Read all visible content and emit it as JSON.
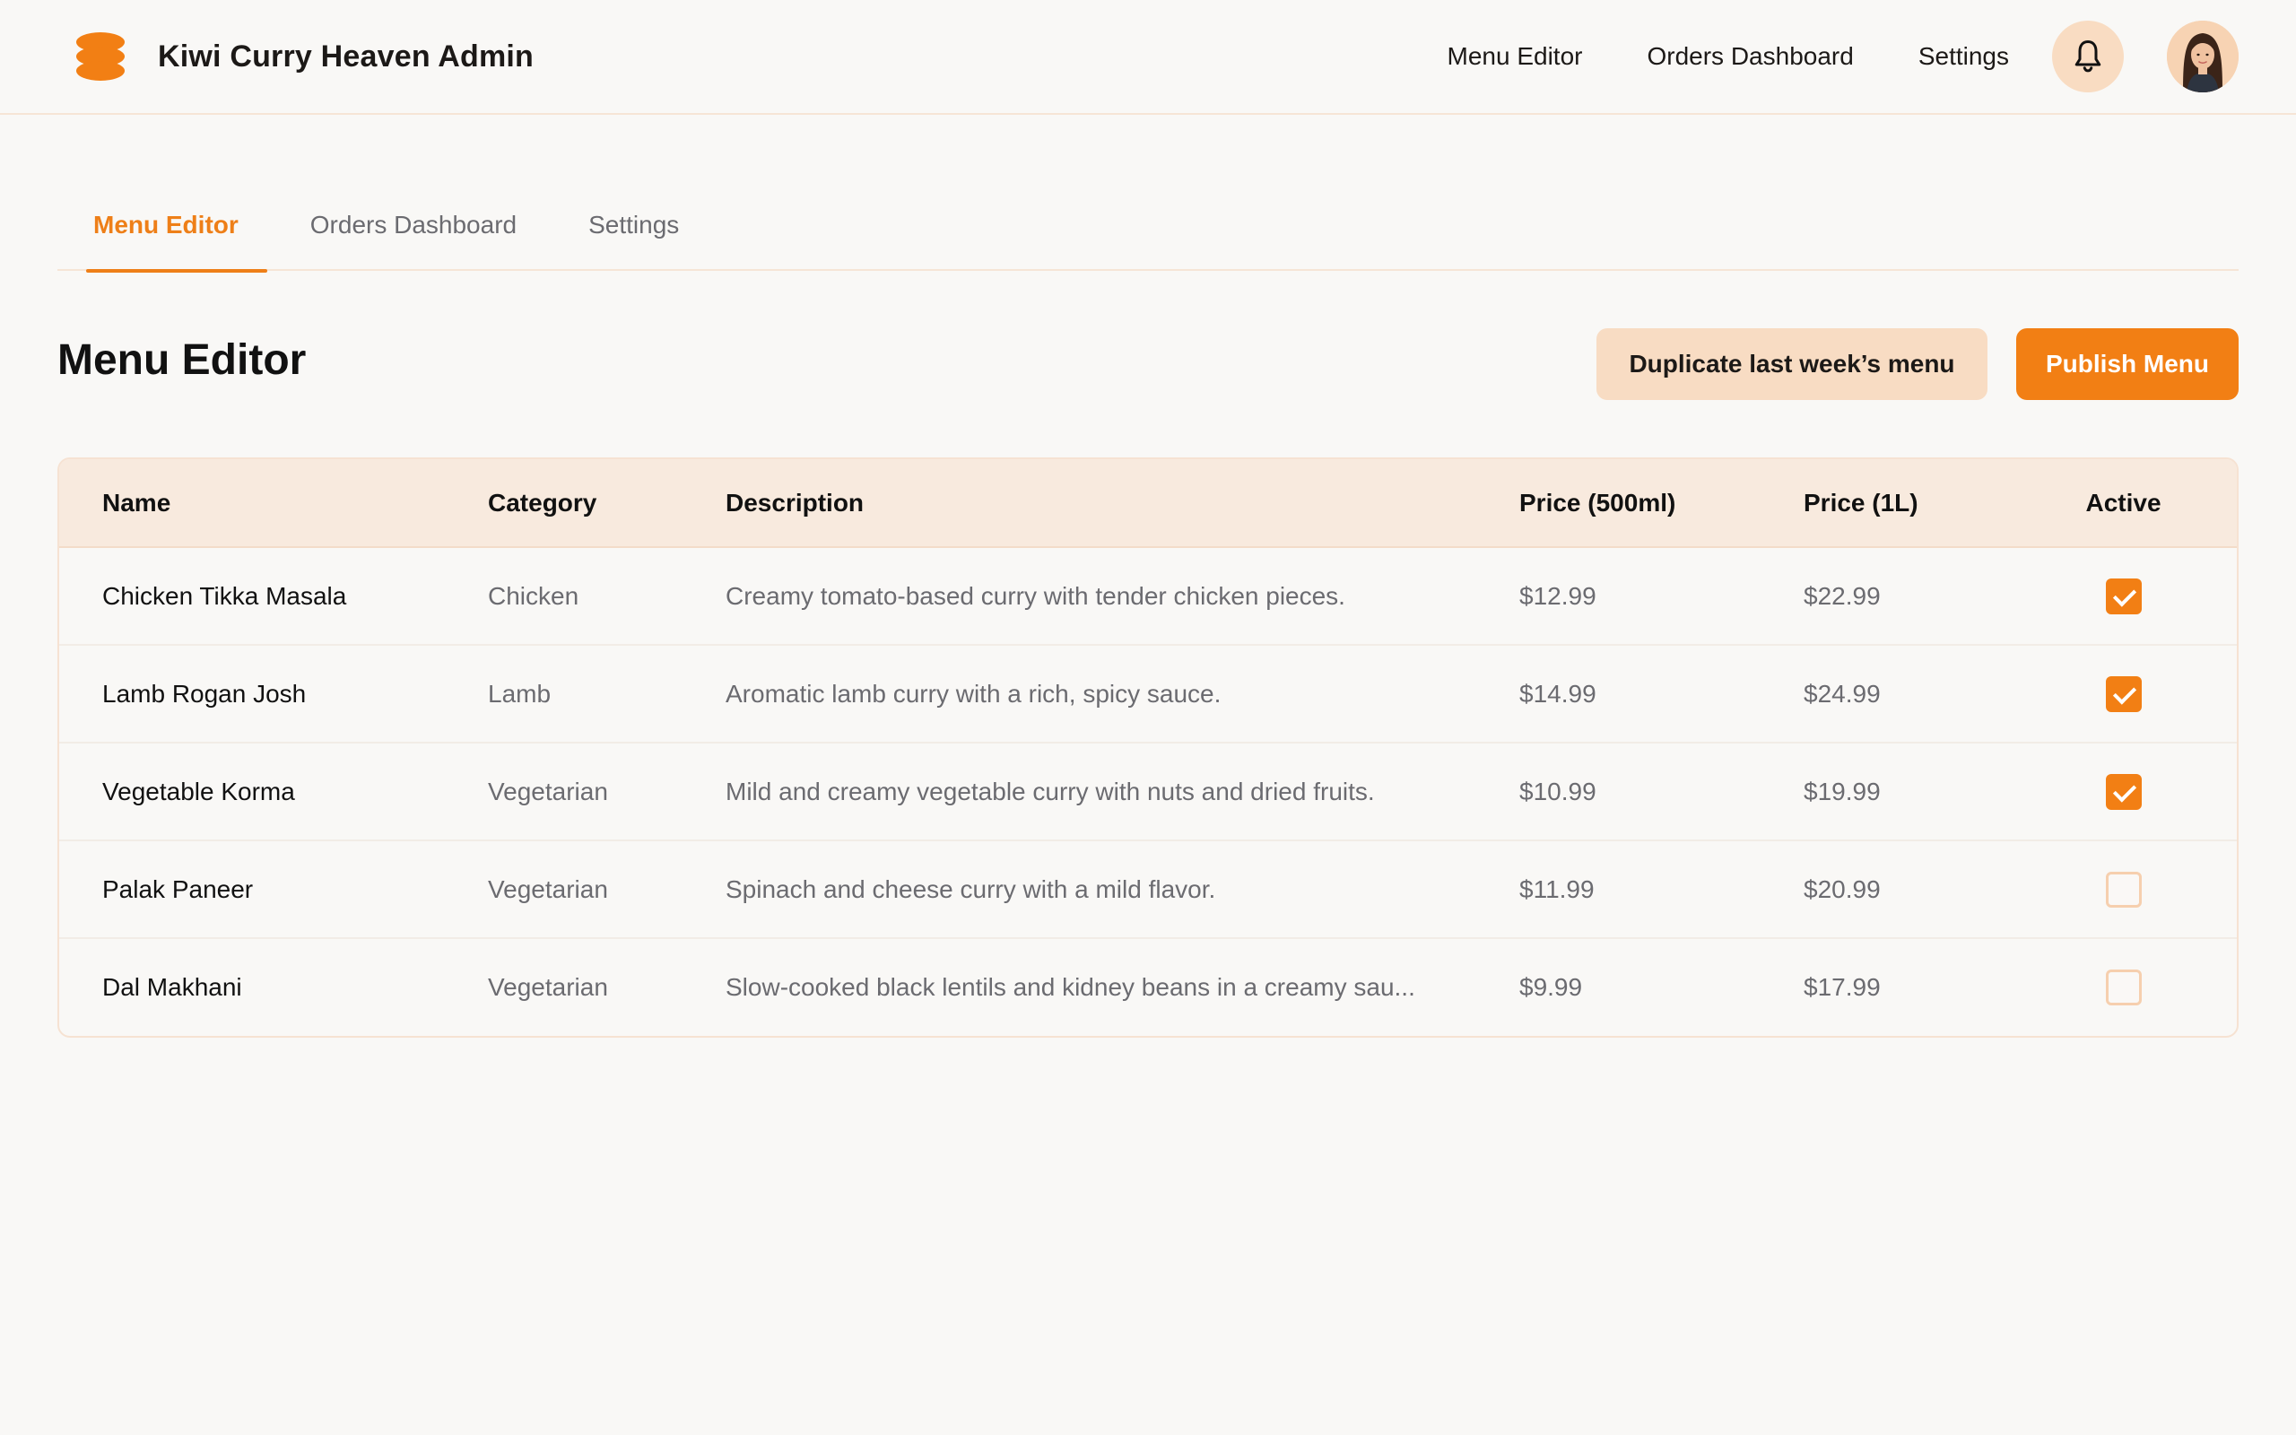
{
  "header": {
    "app_title": "Kiwi Curry Heaven Admin",
    "nav": [
      {
        "label": "Menu Editor"
      },
      {
        "label": "Orders Dashboard"
      },
      {
        "label": "Settings"
      }
    ],
    "notification_icon": "bell-icon",
    "avatar_icon": "user-avatar"
  },
  "tabs": [
    {
      "label": "Menu Editor",
      "active": true
    },
    {
      "label": "Orders Dashboard",
      "active": false
    },
    {
      "label": "Settings",
      "active": false
    }
  ],
  "page": {
    "title": "Menu Editor",
    "duplicate_label": "Duplicate last week’s menu",
    "publish_label": "Publish Menu"
  },
  "table": {
    "columns": [
      "Name",
      "Category",
      "Description",
      "Price (500ml)",
      "Price (1L)",
      "Active"
    ],
    "rows": [
      {
        "name": "Chicken Tikka Masala",
        "category": "Chicken",
        "description": "Creamy tomato-based curry with tender chicken pieces.",
        "price_500": "$12.99",
        "price_1l": "$22.99",
        "active": true
      },
      {
        "name": "Lamb Rogan Josh",
        "category": "Lamb",
        "description": "Aromatic lamb curry with a rich, spicy sauce.",
        "price_500": "$14.99",
        "price_1l": "$24.99",
        "active": true
      },
      {
        "name": "Vegetable Korma",
        "category": "Vegetarian",
        "description": "Mild and creamy vegetable curry with nuts and dried fruits.",
        "price_500": "$10.99",
        "price_1l": "$19.99",
        "active": true
      },
      {
        "name": "Palak Paneer",
        "category": "Vegetarian",
        "description": "Spinach and cheese curry with a mild flavor.",
        "price_500": "$11.99",
        "price_1l": "$20.99",
        "active": false
      },
      {
        "name": "Dal Makhani",
        "category": "Vegetarian",
        "description": "Slow-cooked black lentils and kidney beans in a creamy sau...",
        "price_500": "$9.99",
        "price_1l": "$17.99",
        "active": false
      }
    ]
  },
  "colors": {
    "accent": "#f27f14",
    "accent_soft": "#f8dcc3",
    "header_row": "#f8eade",
    "background": "#f9f8f6"
  }
}
